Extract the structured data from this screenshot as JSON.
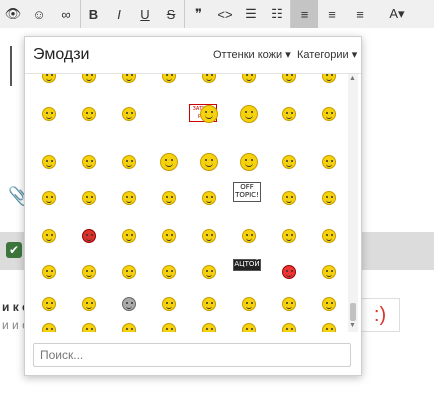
{
  "toolbar": {
    "buttons": [
      {
        "name": "preview-button",
        "icon": "eye-icon",
        "glyph": "👁"
      },
      {
        "name": "emoji-button",
        "icon": "smile-icon",
        "glyph": "☺"
      },
      {
        "name": "link-button",
        "icon": "link-icon",
        "glyph": "∞"
      },
      {
        "name": "bold-button",
        "icon": "bold-icon",
        "glyph": "B"
      },
      {
        "name": "italic-button",
        "icon": "italic-icon",
        "glyph": "I"
      },
      {
        "name": "underline-button",
        "icon": "underline-icon",
        "glyph": "U"
      },
      {
        "name": "strike-button",
        "icon": "strike-icon",
        "glyph": "S"
      },
      {
        "name": "quote-button",
        "icon": "quote-icon",
        "glyph": "❞"
      },
      {
        "name": "code-button",
        "icon": "code-icon",
        "glyph": "<>"
      },
      {
        "name": "bullet-list-button",
        "icon": "list-icon",
        "glyph": "☰"
      },
      {
        "name": "numbered-list-button",
        "icon": "numbered-list-icon",
        "glyph": "☷"
      },
      {
        "name": "align-left-button",
        "icon": "align-left-icon",
        "glyph": "≡",
        "active": true
      },
      {
        "name": "align-center-button",
        "icon": "align-center-icon",
        "glyph": "≡"
      },
      {
        "name": "align-right-button",
        "icon": "align-right-icon",
        "glyph": "≡"
      },
      {
        "name": "text-color-button",
        "icon": "text-color-icon",
        "glyph": "A▾"
      }
    ]
  },
  "popup": {
    "title": "Эмодзи",
    "skin_tone_label": "Оттенки кожи",
    "categories_label": "Категории",
    "search_placeholder": "Поиск...",
    "sign_texts": {
      "shutup": "ЗАТКНИ РОТ",
      "offtopic1": "OFF",
      "offtopic2": "TOPIC!",
      "autor": "АЦТОЙ"
    }
  },
  "page": {
    "bottom_text_1": "и к спи",
    "bottom_text_2": "и и об",
    "smile_label": ":)"
  },
  "colors": {
    "accent_smile": "#d9322b",
    "emoji_yellow": "#f6d20c",
    "check_green": "#3c763d"
  }
}
